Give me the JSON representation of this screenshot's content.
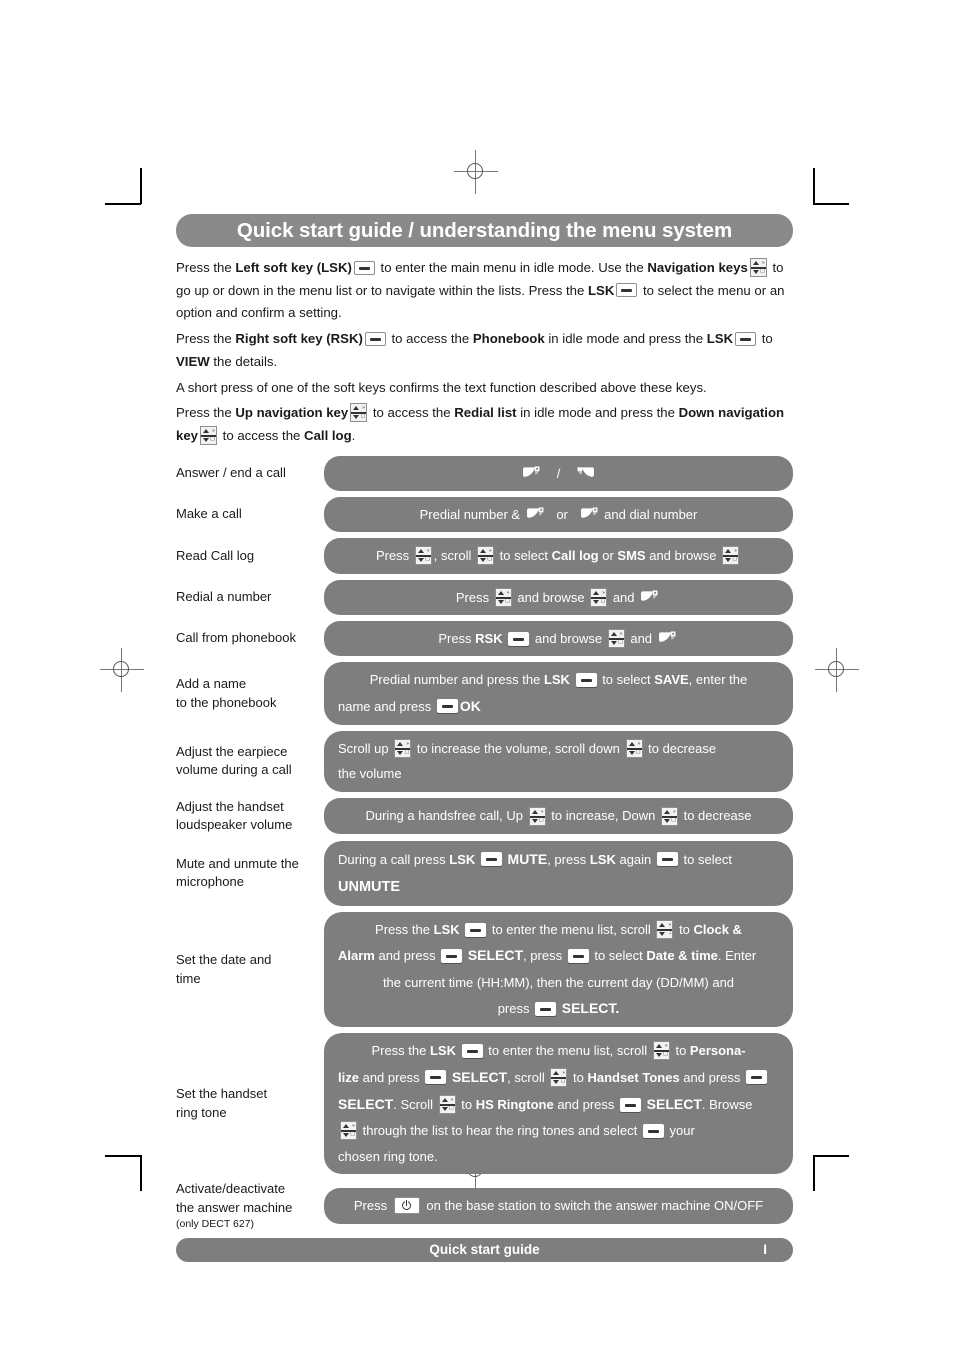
{
  "header": {
    "title": "Quick start guide / understanding the menu system"
  },
  "intro": {
    "p1_a": "Press the ",
    "p1_b1": "Left soft key (LSK)",
    "p1_c": " to enter the main menu in idle mode. Use the ",
    "p1_b2": "Navigation keys",
    "p1_d": " to go up or down in the menu list or to navigate within the lists. Press the ",
    "p1_b3": "LSK",
    "p1_e": " to select the menu or an option and confirm a setting.",
    "p2_a": "Press the ",
    "p2_b1": "Right soft key (RSK)",
    "p2_c": " to access the ",
    "p2_b2": "Phonebook",
    "p2_d": " in idle mode and press the ",
    "p2_b3": "LSK",
    "p2_e": " to ",
    "p2_b4": "VIEW",
    "p2_f": " the details.",
    "p3": "A short press of one of the soft keys confirms the text function described above these keys.",
    "p4_a": "Press the ",
    "p4_b1": "Up navigation key",
    "p4_c": " to access the ",
    "p4_b2": "Redial list",
    "p4_d": " in idle mode and press the ",
    "p4_b3": "Down navigation key",
    "p4_e": " to access the ",
    "p4_b4": "Call log",
    "p4_f": "."
  },
  "rows": [
    {
      "label": "Answer / end a call",
      "seg": [
        "icon:answer-call",
        "text: / ",
        "icon:end-call"
      ]
    },
    {
      "label": "Make a call",
      "seg": [
        "text:Predial number & ",
        "icon:answer-call",
        "text: or ",
        "icon:answer-call",
        "text: and dial number"
      ]
    },
    {
      "label": "Read Call log",
      "seg": [
        "text:Press ",
        "icon:nav-key",
        "text:, scroll ",
        "icon:nav-key",
        "text: to select ",
        "bold:Call log",
        "text: or ",
        "bold:SMS",
        "text: and browse ",
        "icon:nav-key"
      ]
    },
    {
      "label": "Redial a number",
      "seg": [
        "text:Press ",
        "icon:nav-key",
        "text: and browse ",
        "icon:nav-key",
        "text: and ",
        "icon:answer-call"
      ]
    },
    {
      "label": "Call from phonebook",
      "seg": [
        "bold:Press RSK ",
        "icon:soft-key",
        "text: and browse ",
        "icon:nav-key",
        "text: and ",
        "icon:answer-call"
      ]
    },
    {
      "label": "Add a name\nto the phonebook",
      "seg": [
        "text:Predial number and press the ",
        "bold:LSK",
        "icon:soft-key",
        "text: to select ",
        "bold:SAVE",
        "text:, enter the name and press ",
        "icon:soft-key",
        "bold:OK"
      ]
    },
    {
      "label": "Adjust the earpiece\nvolume during a call",
      "seg": [
        "text:Scroll up ",
        "icon:nav-key",
        "text: to increase the volume, scroll down ",
        "icon:nav-key",
        "text: to decrease the volume"
      ]
    },
    {
      "label": "Adjust the handset\nloudspeaker volume",
      "seg": [
        "text:During a handsfree call, Up ",
        "icon:nav-key",
        "text: to increase, Down ",
        "icon:nav-key",
        "text: to decrease"
      ]
    },
    {
      "label": "Mute and unmute the\nmicrophone",
      "seg": [
        "text:During a call press ",
        "bold:LSK",
        "icon:soft-key",
        "bold:MUTE",
        "text:, press ",
        "bold:LSK",
        "text: again ",
        "icon:soft-key",
        "text: to select ",
        "bold:UNMUTE"
      ]
    },
    {
      "label": "Set the date and\ntime",
      "seg": [
        "text:Press the ",
        "bold:LSK",
        "icon:soft-key",
        "text: to enter the menu list, scroll ",
        "icon:nav-key",
        "text: to ",
        "bold:Clock & Alarm",
        "text: and press ",
        "icon:soft-key",
        "bold:SELECT",
        "text:, press ",
        "icon:soft-key",
        "text: to select ",
        "bold:Date & time",
        "text:. Enter the current time (HH:MM), then the current day (DD/MM) and press ",
        "icon:soft-key",
        "bold:SELECT."
      ]
    },
    {
      "label": "Set the handset\nring tone",
      "seg": [
        "text:Press the ",
        "bold:LSK",
        "icon:soft-key",
        "text: to enter the menu list, scroll ",
        "icon:nav-key",
        "text: to ",
        "bold:Personalize",
        "text: and press ",
        "icon:soft-key",
        "bold:SELECT",
        "text:, scroll ",
        "icon:nav-key",
        "text: to ",
        "bold:Handset Tones",
        "text: and press ",
        "icon:soft-key",
        "bold:SELECT",
        "text:. Scroll ",
        "icon:nav-key",
        "text: to ",
        "bold:HS Ringtone",
        "text: and press ",
        "icon:soft-key",
        "bold:SELECT",
        "text:. Browse ",
        "icon:nav-key",
        "text: through the list to hear the ring tones and select ",
        "icon:soft-key",
        "text: your chosen ring tone."
      ]
    },
    {
      "label": "Activate/deactivate\nthe answer machine",
      "label_sub": "(only DECT 627)",
      "seg": [
        "text:Press ",
        "icon:power",
        "text: on the base station to switch the answer machine ON/OFF"
      ]
    }
  ],
  "row_texts": {
    "r1_sep": "/",
    "r2_a": "Predial number &",
    "r2_b": "or",
    "r2_c": "and dial number",
    "r3_a": "Press",
    "r3_b": ", scroll",
    "r3_c": "to select",
    "r3_d": "Call log",
    "r3_e": "or",
    "r3_f": "SMS",
    "r3_g": "and browse",
    "r4_a": "Press",
    "r4_b": "and browse",
    "r4_c": "and",
    "r5_a": "Press",
    "r5_b": "RSK",
    "r5_c": "and browse",
    "r5_d": "and",
    "r6_a": "Predial number and press the",
    "r6_b": "LSK",
    "r6_c": "to select",
    "r6_d": "SAVE",
    "r6_e": ", enter the",
    "r6_f": "name and press",
    "r6_g": "OK",
    "r7_a": "Scroll up",
    "r7_b": "to increase the volume, scroll down",
    "r7_c": "to decrease",
    "r7_d": "the volume",
    "r8_a": "During a handsfree call, Up",
    "r8_b": "to increase, Down",
    "r8_c": "to decrease",
    "r9_a": "During a call press",
    "r9_b": "LSK",
    "r9_c": "MUTE",
    "r9_d": ", press",
    "r9_e": "LSK",
    "r9_f": "again",
    "r9_g": "to select",
    "r9_h": "UNMUTE",
    "r10_a": "Press the",
    "r10_b": "LSK",
    "r10_c": "to enter the menu list, scroll",
    "r10_d": "to",
    "r10_e": "Clock &",
    "r10_f": "Alarm",
    "r10_g": "and press",
    "r10_h": "SELECT",
    "r10_i": ", press",
    "r10_j": "to select",
    "r10_k": "Date & time",
    "r10_l": ". Enter",
    "r10_m": "the current time (HH:MM), then the current day (DD/MM) and",
    "r10_n": "press",
    "r10_o": "SELECT.",
    "r11_a": "Press the",
    "r11_b": "LSK",
    "r11_c": "to enter the menu list, scroll",
    "r11_d": "to",
    "r11_e": "Persona-",
    "r11_f": "lize",
    "r11_g": "and press",
    "r11_h": "SELECT",
    "r11_i": ", scroll",
    "r11_j": "to",
    "r11_k": "Handset Tones",
    "r11_l": "and press",
    "r11_m": "SELECT",
    "r11_n": ". Scroll",
    "r11_o": "to",
    "r11_p": "HS Ringtone",
    "r11_q": "and press",
    "r11_r": "SELECT",
    "r11_s": ". Browse",
    "r11_t": "through the list to hear the ring tones and select",
    "r11_u": "your",
    "r11_v": "chosen ring tone.",
    "r12_a": "Press",
    "r12_b": "on the base station to switch the answer machine ON/OFF"
  },
  "labels": {
    "l1": "Answer / end a call",
    "l2": "Make a call",
    "l3": "Read Call log",
    "l4": "Redial a number",
    "l5": "Call from phonebook",
    "l6a": "Add a name",
    "l6b": "to the phonebook",
    "l7a": "Adjust the earpiece",
    "l7b": "volume during a call",
    "l8a": "Adjust the handset",
    "l8b": "loudspeaker volume",
    "l9a": "Mute and unmute the",
    "l9b": "microphone",
    "l10a": "Set the date and",
    "l10b": "time",
    "l11a": "Set the handset",
    "l11b": "ring tone",
    "l12a": "Activate/deactivate",
    "l12b": "the answer machine",
    "l12c": "(only DECT 627)"
  },
  "footer": {
    "title": "Quick start guide",
    "page": "I"
  },
  "colors": {
    "bubble_grey": "#7e7e7e",
    "header_grey": "#8a8a8a",
    "text": "#1a1a1a",
    "white": "#ffffff"
  }
}
